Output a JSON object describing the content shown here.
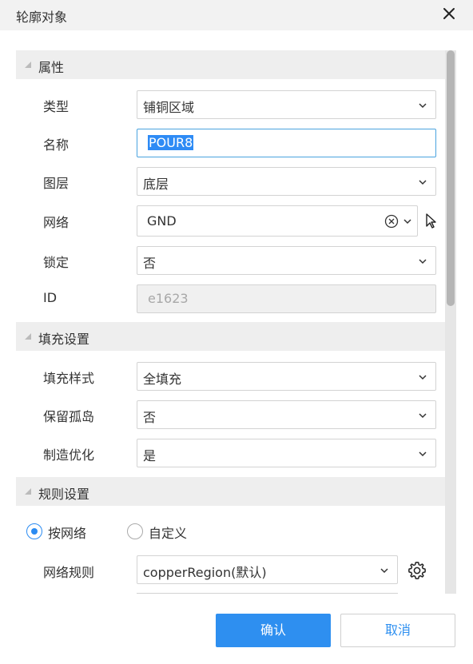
{
  "dialog": {
    "title": "轮廓对象"
  },
  "sections": {
    "properties": "属性",
    "fill": "填充设置",
    "rules": "规则设置"
  },
  "properties": {
    "type": {
      "label": "类型",
      "value": "铺铜区域"
    },
    "name": {
      "label": "名称",
      "value": "POUR8"
    },
    "layer": {
      "label": "图层",
      "value": "底层"
    },
    "net": {
      "label": "网络",
      "value": "GND"
    },
    "lock": {
      "label": "锁定",
      "value": "否"
    },
    "id": {
      "label": "ID",
      "value": "e1623"
    }
  },
  "fill": {
    "style": {
      "label": "填充样式",
      "value": "全填充"
    },
    "keep_islands": {
      "label": "保留孤岛",
      "value": "否"
    },
    "mfg_optimize": {
      "label": "制造优化",
      "value": "是"
    }
  },
  "rules": {
    "radio_by_net": "按网络",
    "radio_custom": "自定义",
    "net_rule": {
      "label": "网络规则",
      "value": "copperRegion(默认)"
    }
  },
  "buttons": {
    "confirm": "确认",
    "cancel": "取消"
  },
  "icons": {
    "close": "close-icon",
    "chevron": "chevron-down-icon",
    "clear": "clear-circle-icon",
    "pointer": "pointer-select-icon",
    "gear": "gear-icon"
  },
  "colors": {
    "accent": "#2e8ff0",
    "section_bg": "#eeeeee",
    "titlebar_bg": "#f2f2f2"
  }
}
